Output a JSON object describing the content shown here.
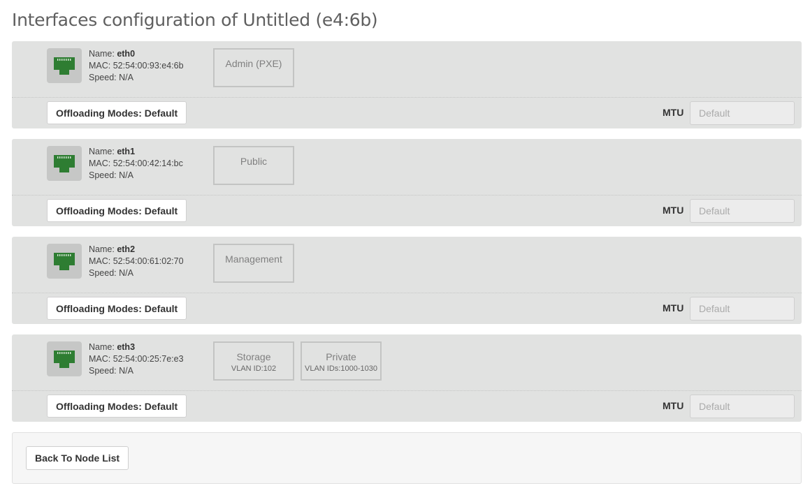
{
  "page": {
    "title": "Interfaces configuration of Untitled (e4:6b)"
  },
  "labels": {
    "name": "Name:",
    "mac": "MAC:",
    "speed": "Speed:",
    "mtu": "MTU"
  },
  "icon": {
    "port": "ethernet-port-icon",
    "port_color": "#2e7d32"
  },
  "interfaces": [
    {
      "name": "eth0",
      "mac": "52:54:00:93:e4:6b",
      "speed": "N/A",
      "networks": [
        {
          "name": "Admin (PXE)",
          "sub": ""
        }
      ],
      "offloading_label": "Offloading Modes: Default",
      "mtu_placeholder": "Default"
    },
    {
      "name": "eth1",
      "mac": "52:54:00:42:14:bc",
      "speed": "N/A",
      "networks": [
        {
          "name": "Public",
          "sub": ""
        }
      ],
      "offloading_label": "Offloading Modes: Default",
      "mtu_placeholder": "Default"
    },
    {
      "name": "eth2",
      "mac": "52:54:00:61:02:70",
      "speed": "N/A",
      "networks": [
        {
          "name": "Management",
          "sub": ""
        }
      ],
      "offloading_label": "Offloading Modes: Default",
      "mtu_placeholder": "Default"
    },
    {
      "name": "eth3",
      "mac": "52:54:00:25:7e:e3",
      "speed": "N/A",
      "networks": [
        {
          "name": "Storage",
          "sub": "VLAN ID:102"
        },
        {
          "name": "Private",
          "sub": "VLAN IDs:1000-1030"
        }
      ],
      "offloading_label": "Offloading Modes: Default",
      "mtu_placeholder": "Default"
    }
  ],
  "footer": {
    "back_label": "Back To Node List"
  }
}
